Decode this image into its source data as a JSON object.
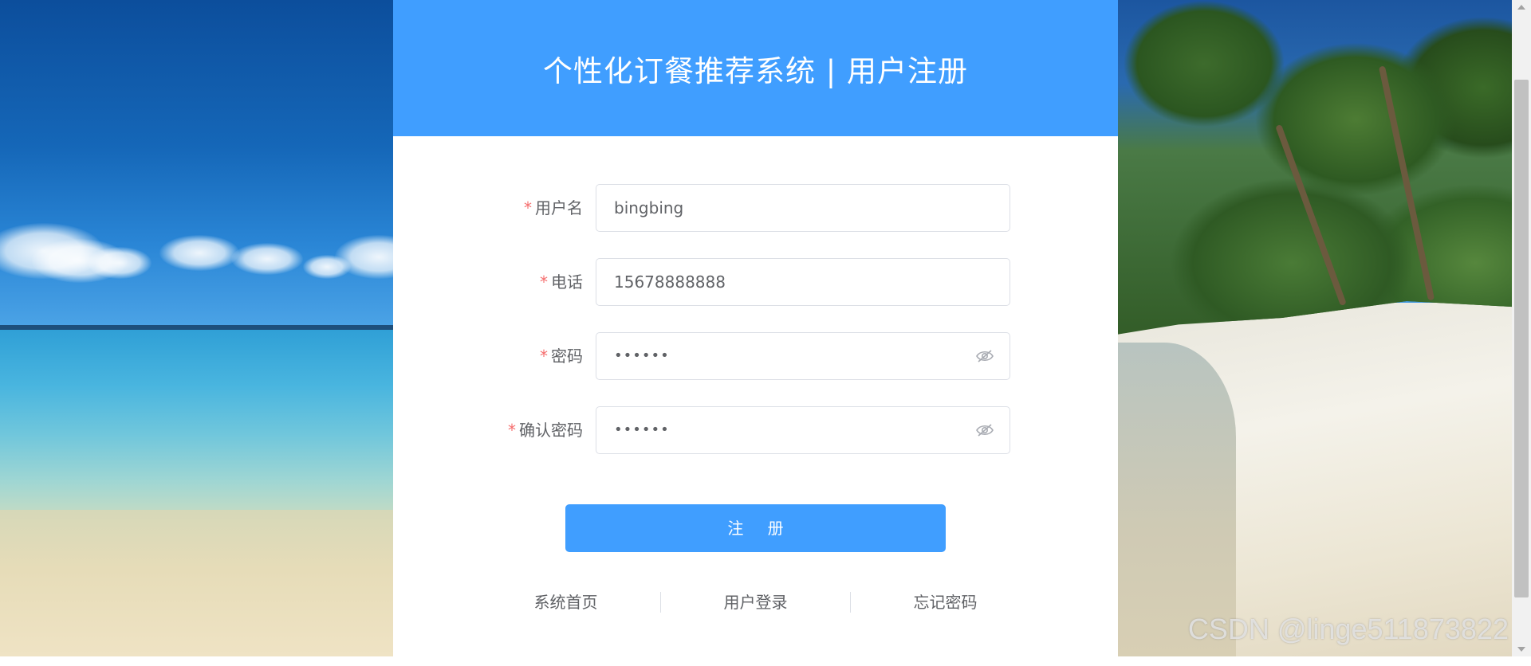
{
  "header": {
    "title": "个性化订餐推荐系统 | 用户注册"
  },
  "form": {
    "required_mark": "*",
    "fields": [
      {
        "label": "用户名",
        "value": "bingbing",
        "type": "text"
      },
      {
        "label": "电话",
        "value": "15678888888",
        "type": "text"
      },
      {
        "label": "密码",
        "value": "••••••",
        "type": "password",
        "icon": "eye-off-icon"
      },
      {
        "label": "确认密码",
        "value": "••••••",
        "type": "password",
        "icon": "eye-off-icon"
      }
    ],
    "submit_label": "注 册"
  },
  "links": {
    "home": "系统首页",
    "login": "用户登录",
    "forgot": "忘记密码"
  },
  "watermark": "CSDN @linge511873822",
  "colors": {
    "primary": "#409eff",
    "required": "#f56c6c",
    "text": "#606266",
    "border": "#dcdfe6"
  }
}
